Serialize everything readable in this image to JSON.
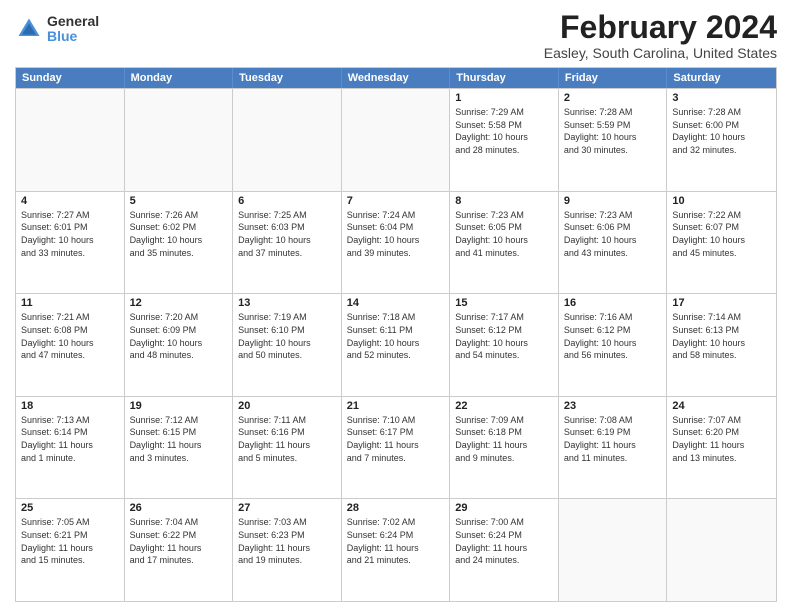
{
  "logo": {
    "general": "General",
    "blue": "Blue"
  },
  "title": "February 2024",
  "subtitle": "Easley, South Carolina, United States",
  "days_of_week": [
    "Sunday",
    "Monday",
    "Tuesday",
    "Wednesday",
    "Thursday",
    "Friday",
    "Saturday"
  ],
  "weeks": [
    [
      {
        "day": "",
        "info": ""
      },
      {
        "day": "",
        "info": ""
      },
      {
        "day": "",
        "info": ""
      },
      {
        "day": "",
        "info": ""
      },
      {
        "day": "1",
        "info": "Sunrise: 7:29 AM\nSunset: 5:58 PM\nDaylight: 10 hours\nand 28 minutes."
      },
      {
        "day": "2",
        "info": "Sunrise: 7:28 AM\nSunset: 5:59 PM\nDaylight: 10 hours\nand 30 minutes."
      },
      {
        "day": "3",
        "info": "Sunrise: 7:28 AM\nSunset: 6:00 PM\nDaylight: 10 hours\nand 32 minutes."
      }
    ],
    [
      {
        "day": "4",
        "info": "Sunrise: 7:27 AM\nSunset: 6:01 PM\nDaylight: 10 hours\nand 33 minutes."
      },
      {
        "day": "5",
        "info": "Sunrise: 7:26 AM\nSunset: 6:02 PM\nDaylight: 10 hours\nand 35 minutes."
      },
      {
        "day": "6",
        "info": "Sunrise: 7:25 AM\nSunset: 6:03 PM\nDaylight: 10 hours\nand 37 minutes."
      },
      {
        "day": "7",
        "info": "Sunrise: 7:24 AM\nSunset: 6:04 PM\nDaylight: 10 hours\nand 39 minutes."
      },
      {
        "day": "8",
        "info": "Sunrise: 7:23 AM\nSunset: 6:05 PM\nDaylight: 10 hours\nand 41 minutes."
      },
      {
        "day": "9",
        "info": "Sunrise: 7:23 AM\nSunset: 6:06 PM\nDaylight: 10 hours\nand 43 minutes."
      },
      {
        "day": "10",
        "info": "Sunrise: 7:22 AM\nSunset: 6:07 PM\nDaylight: 10 hours\nand 45 minutes."
      }
    ],
    [
      {
        "day": "11",
        "info": "Sunrise: 7:21 AM\nSunset: 6:08 PM\nDaylight: 10 hours\nand 47 minutes."
      },
      {
        "day": "12",
        "info": "Sunrise: 7:20 AM\nSunset: 6:09 PM\nDaylight: 10 hours\nand 48 minutes."
      },
      {
        "day": "13",
        "info": "Sunrise: 7:19 AM\nSunset: 6:10 PM\nDaylight: 10 hours\nand 50 minutes."
      },
      {
        "day": "14",
        "info": "Sunrise: 7:18 AM\nSunset: 6:11 PM\nDaylight: 10 hours\nand 52 minutes."
      },
      {
        "day": "15",
        "info": "Sunrise: 7:17 AM\nSunset: 6:12 PM\nDaylight: 10 hours\nand 54 minutes."
      },
      {
        "day": "16",
        "info": "Sunrise: 7:16 AM\nSunset: 6:12 PM\nDaylight: 10 hours\nand 56 minutes."
      },
      {
        "day": "17",
        "info": "Sunrise: 7:14 AM\nSunset: 6:13 PM\nDaylight: 10 hours\nand 58 minutes."
      }
    ],
    [
      {
        "day": "18",
        "info": "Sunrise: 7:13 AM\nSunset: 6:14 PM\nDaylight: 11 hours\nand 1 minute."
      },
      {
        "day": "19",
        "info": "Sunrise: 7:12 AM\nSunset: 6:15 PM\nDaylight: 11 hours\nand 3 minutes."
      },
      {
        "day": "20",
        "info": "Sunrise: 7:11 AM\nSunset: 6:16 PM\nDaylight: 11 hours\nand 5 minutes."
      },
      {
        "day": "21",
        "info": "Sunrise: 7:10 AM\nSunset: 6:17 PM\nDaylight: 11 hours\nand 7 minutes."
      },
      {
        "day": "22",
        "info": "Sunrise: 7:09 AM\nSunset: 6:18 PM\nDaylight: 11 hours\nand 9 minutes."
      },
      {
        "day": "23",
        "info": "Sunrise: 7:08 AM\nSunset: 6:19 PM\nDaylight: 11 hours\nand 11 minutes."
      },
      {
        "day": "24",
        "info": "Sunrise: 7:07 AM\nSunset: 6:20 PM\nDaylight: 11 hours\nand 13 minutes."
      }
    ],
    [
      {
        "day": "25",
        "info": "Sunrise: 7:05 AM\nSunset: 6:21 PM\nDaylight: 11 hours\nand 15 minutes."
      },
      {
        "day": "26",
        "info": "Sunrise: 7:04 AM\nSunset: 6:22 PM\nDaylight: 11 hours\nand 17 minutes."
      },
      {
        "day": "27",
        "info": "Sunrise: 7:03 AM\nSunset: 6:23 PM\nDaylight: 11 hours\nand 19 minutes."
      },
      {
        "day": "28",
        "info": "Sunrise: 7:02 AM\nSunset: 6:24 PM\nDaylight: 11 hours\nand 21 minutes."
      },
      {
        "day": "29",
        "info": "Sunrise: 7:00 AM\nSunset: 6:24 PM\nDaylight: 11 hours\nand 24 minutes."
      },
      {
        "day": "",
        "info": ""
      },
      {
        "day": "",
        "info": ""
      }
    ]
  ]
}
